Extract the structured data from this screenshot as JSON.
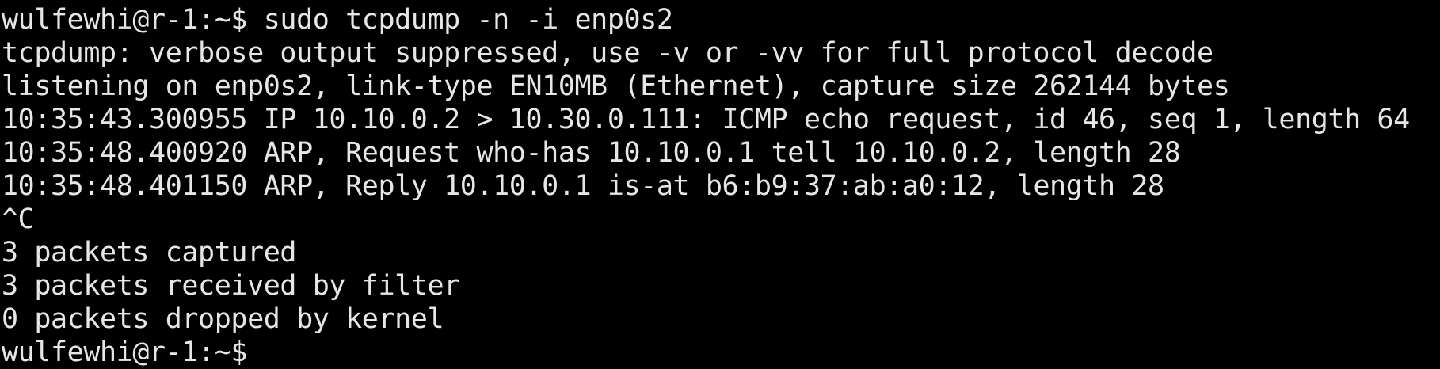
{
  "terminal": {
    "lines": [
      "wulfewhi@r-1:~$ sudo tcpdump -n -i enp0s2",
      "tcpdump: verbose output suppressed, use -v or -vv for full protocol decode",
      "listening on enp0s2, link-type EN10MB (Ethernet), capture size 262144 bytes",
      "10:35:43.300955 IP 10.10.0.2 > 10.30.0.111: ICMP echo request, id 46, seq 1, length 64",
      "10:35:48.400920 ARP, Request who-has 10.10.0.1 tell 10.10.0.2, length 28",
      "10:35:48.401150 ARP, Reply 10.10.0.1 is-at b6:b9:37:ab:a0:12, length 28",
      "^C",
      "3 packets captured",
      "3 packets received by filter",
      "0 packets dropped by kernel",
      "wulfewhi@r-1:~$"
    ]
  }
}
